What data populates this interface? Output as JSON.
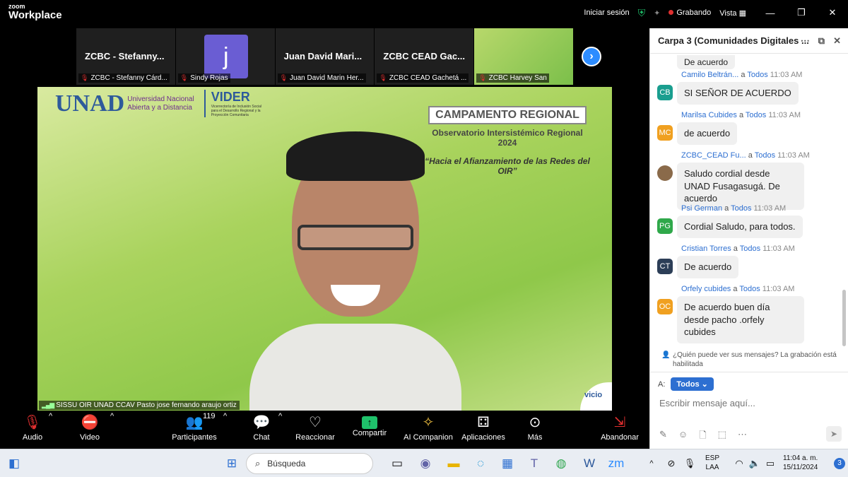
{
  "app": {
    "logo_line1": "zoom",
    "logo_line2": "Workplace"
  },
  "topbar": {
    "signin": "Iniciar sesión",
    "recording": "Grabando",
    "view": "Vista"
  },
  "strip": [
    {
      "name": "ZCBC - Stefanny...",
      "label": "ZCBC - Stefanny Cárd..."
    },
    {
      "name": "",
      "label": "Sindy Rojas",
      "avatar": "j"
    },
    {
      "name": "Juan David Mari...",
      "label": "Juan David Marin Her..."
    },
    {
      "name": "ZCBC CEAD Gac...",
      "label": "ZCBC CEAD Gachetá ..."
    },
    {
      "name": "",
      "label": "ZCBC Harvey San"
    }
  ],
  "stage": {
    "unad": "UNAD",
    "unad_sub1": "Universidad Nacional",
    "unad_sub2": "Abierta y a Distancia",
    "vider": "VIDER",
    "vider_sub": "Vicerrectoría de Inclusión Social para el Desarrollo Regional y la Proyección Comunitaria",
    "camp_title": "CAMPAMENTO REGIONAL",
    "camp_sub": "Observatorio Intersistémico Regional 2024",
    "camp_quote": "“Hacia el Afianzamiento de las Redes del OIR”",
    "speaker": "SISSU OIR UNAD CCAV Pasto jose fernando araujo ortiz",
    "corner": "vicio"
  },
  "controls": {
    "audio": "Audio",
    "video": "Video",
    "participants": "Participantes",
    "participants_count": "119",
    "chat": "Chat",
    "reactions": "Reaccionar",
    "share": "Compartir",
    "ai": "AI Companion",
    "apps": "Aplicaciones",
    "more": "Más",
    "leave": "Abandonar"
  },
  "chat": {
    "title": "Carpa 3 (Comunidades Digitales ...",
    "top_text": "De acuerdo",
    "messages": [
      {
        "sender": "Camilo Beltrán...",
        "to": "Todos",
        "time": "11:03 AM",
        "initials": "CB",
        "color": "#1a9e8f",
        "text": "SI SEÑOR DE ACUERDO"
      },
      {
        "sender": "Marilsa Cubides",
        "to": "Todos",
        "time": "11:03 AM",
        "initials": "MC",
        "color": "#f0a020",
        "text": "de acuerdo"
      },
      {
        "sender": "ZCBC_CEAD Fu...",
        "to": "Todos",
        "time": "11:03 AM",
        "initials": "",
        "color": "#8a6a4a",
        "text": "Saludo cordial desde UNAD Fusagasugá. De acuerdo"
      },
      {
        "sender": "Psi German",
        "to": "Todos",
        "time": "11:03 AM",
        "initials": "PG",
        "color": "#2fa84a",
        "text": "Cordial Saludo, para todos."
      },
      {
        "sender": "Cristian Torres",
        "to": "Todos",
        "time": "11:03 AM",
        "initials": "CT",
        "color": "#2c3e57",
        "text": "De acuerdo"
      },
      {
        "sender": "Orfely cubides",
        "to": "Todos",
        "time": "11:03 AM",
        "initials": "OC",
        "color": "#f0a020",
        "text": "De acuerdo buen día desde pacho .orfely cubides"
      }
    ],
    "privacy": "¿Quién puede ver sus mensajes? La grabación está habilitada",
    "to_label": "A:",
    "to_value": "Todos",
    "placeholder": "Escribir mensaje aquí..."
  },
  "taskbar": {
    "search": "Búsqueda",
    "lang1": "ESP",
    "lang2": "LAA",
    "time": "11:04 a. m.",
    "date": "15/11/2024",
    "badge": "3"
  }
}
